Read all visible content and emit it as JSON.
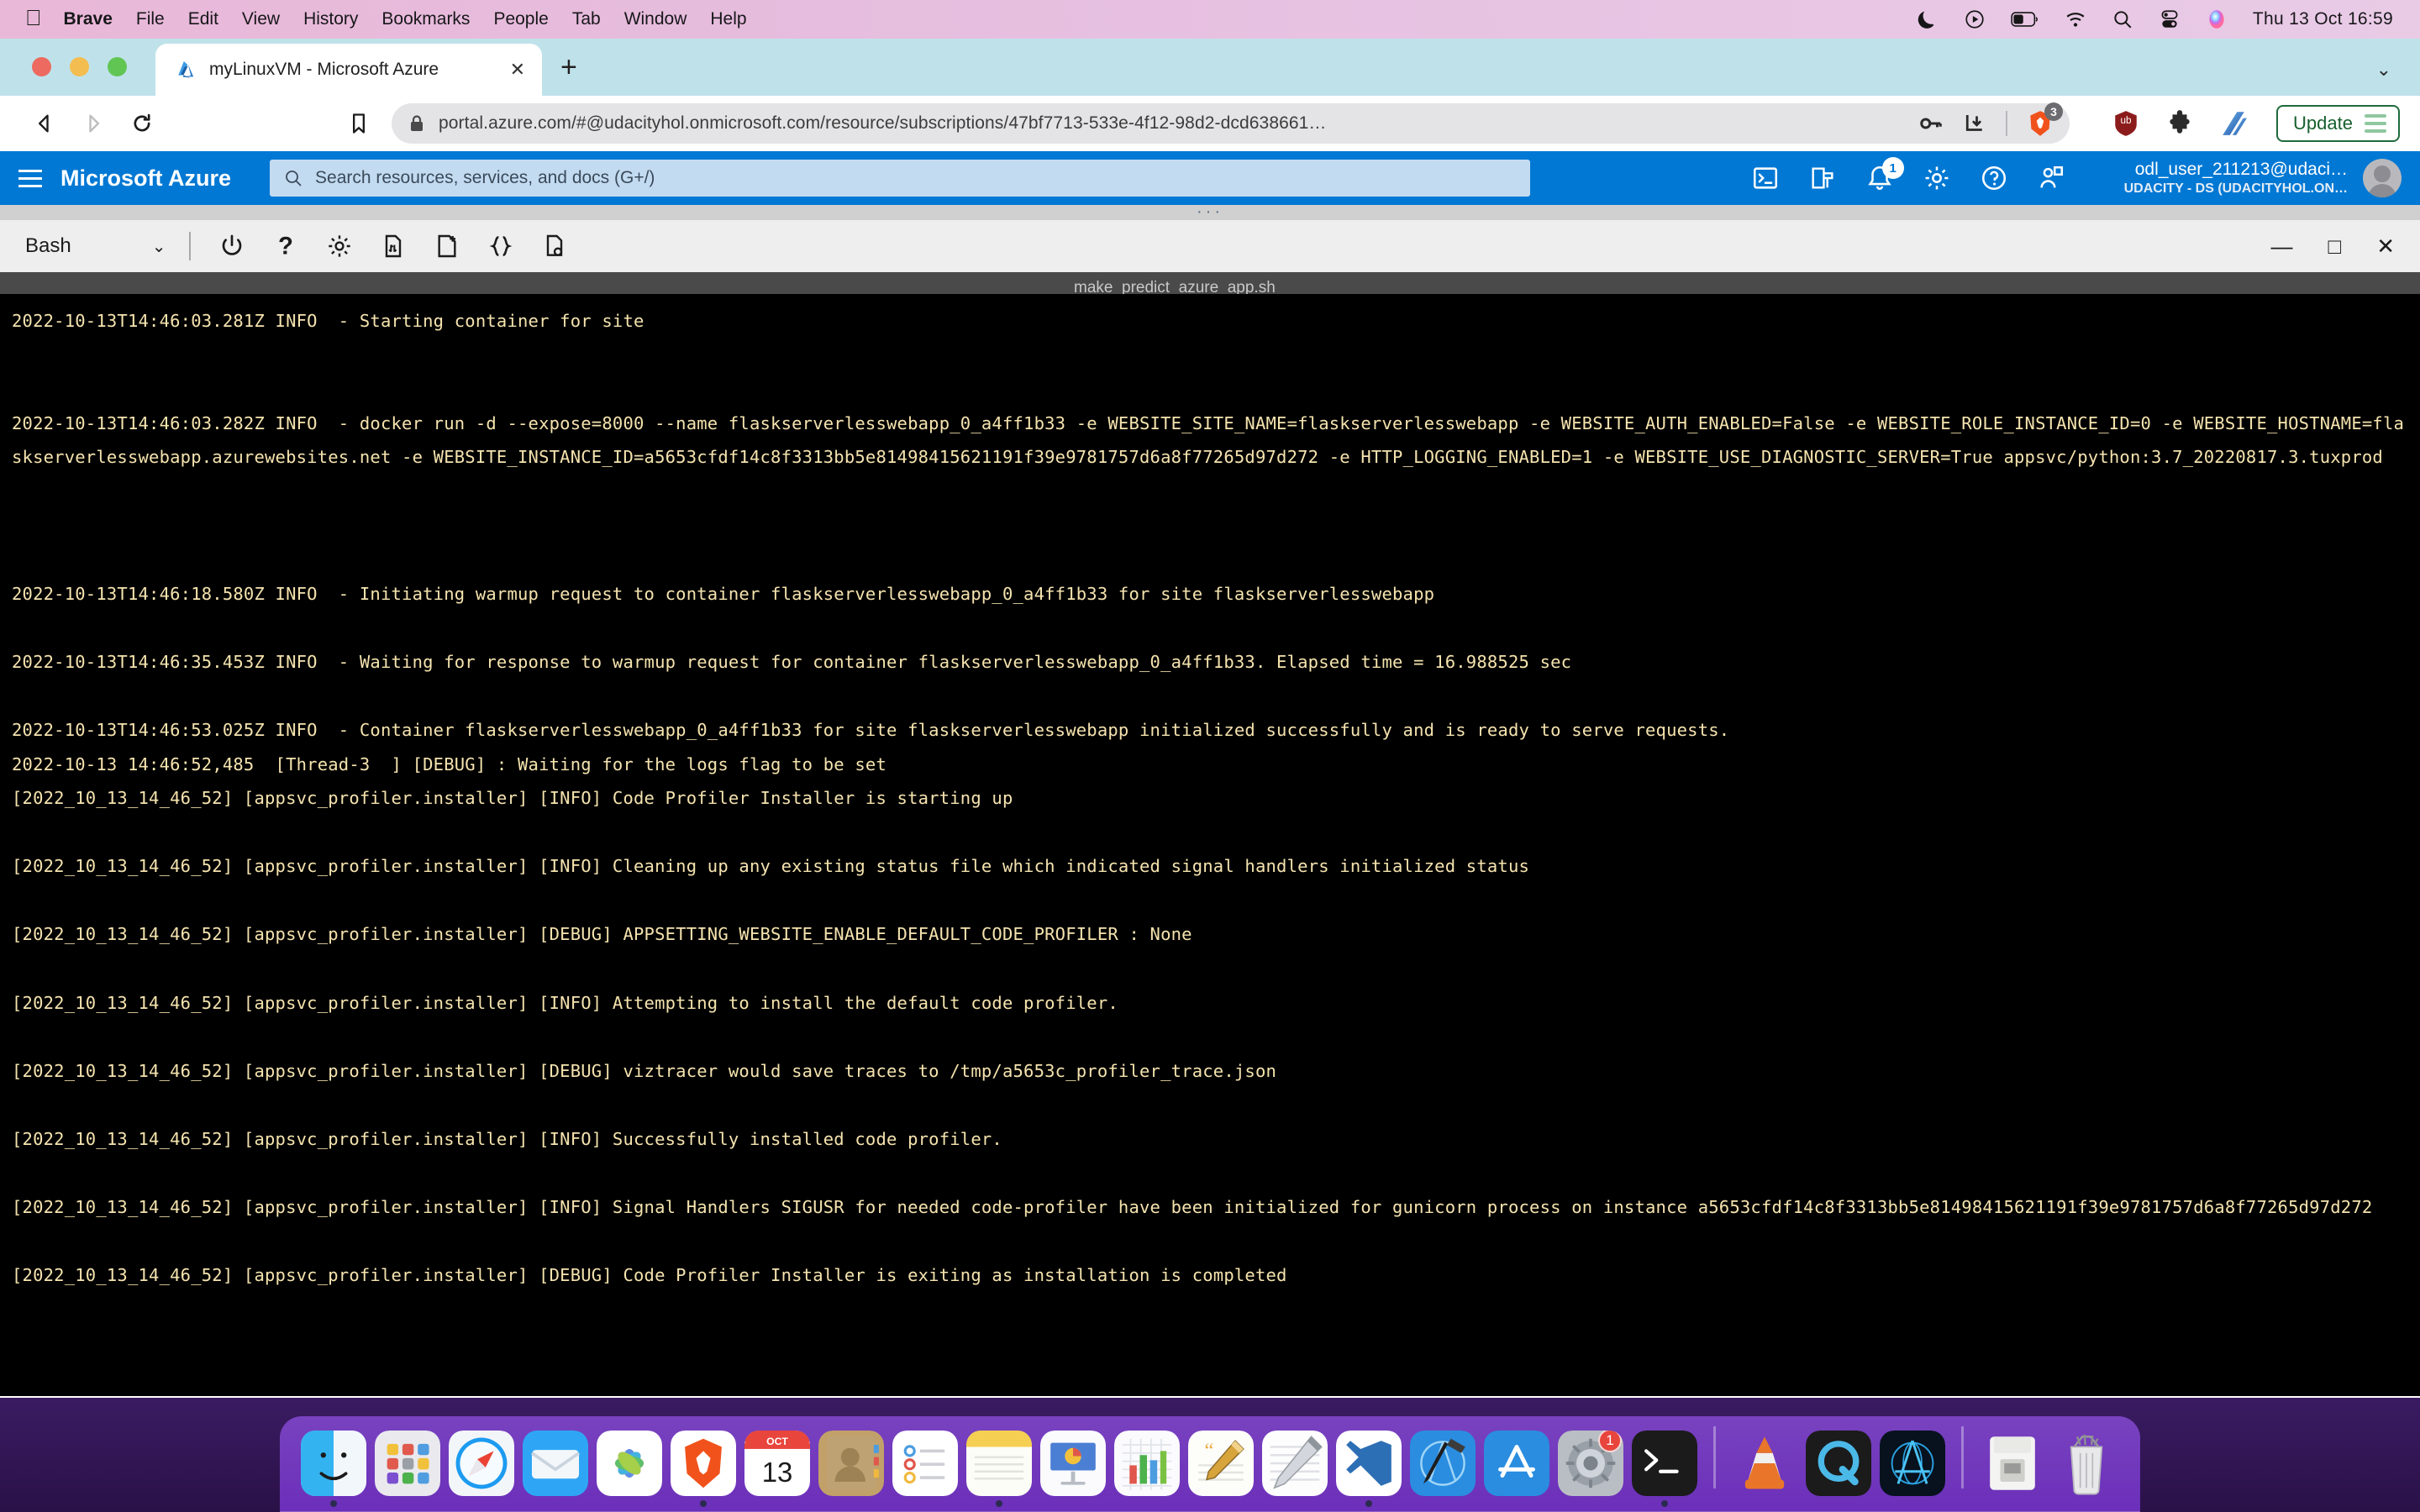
{
  "menubar": {
    "apple_icon": "apple-logo-icon",
    "items": [
      {
        "label": "Brave",
        "bold": true
      },
      {
        "label": "File",
        "bold": false
      },
      {
        "label": "Edit",
        "bold": false
      },
      {
        "label": "View",
        "bold": false
      },
      {
        "label": "History",
        "bold": false
      },
      {
        "label": "Bookmarks",
        "bold": false
      },
      {
        "label": "People",
        "bold": false
      },
      {
        "label": "Tab",
        "bold": false
      },
      {
        "label": "Window",
        "bold": false
      },
      {
        "label": "Help",
        "bold": false
      }
    ],
    "status_icons": [
      "moon-icon",
      "play-circle-icon",
      "battery-icon",
      "wifi-icon",
      "search-icon",
      "control-center-icon",
      "siri-icon"
    ],
    "clock": "Thu 13 Oct  16:59",
    "bg_color": "#e7bfdf"
  },
  "browser": {
    "tab": {
      "favicon": "azure-logo-icon",
      "title": "myLinuxVM - Microsoft Azure",
      "close_label": "✕"
    },
    "new_tab_label": "+",
    "tabstrip_chevron": "⌄",
    "nav": {
      "back_icon": "back-arrow-icon",
      "forward_icon": "forward-arrow-icon",
      "reload_icon": "reload-icon",
      "bookmark_icon": "bookmark-icon"
    },
    "omnibox": {
      "lock_icon": "lock-icon",
      "url": "portal.azure.com/#@udacityhol.onmicrosoft.com/resource/subscriptions/47bf7713-533e-4f12-98d2-dcd638661…",
      "key_icon": "password-key-icon",
      "download_icon": "download-icon",
      "brave_shield_icon": "brave-lion-icon",
      "brave_shield_count": "3"
    },
    "extensions": [
      {
        "name": "ublock-origin-icon"
      },
      {
        "name": "puzzle-extensions-icon"
      },
      {
        "name": "grammarly-icon"
      }
    ],
    "update_button": {
      "label": "Update",
      "menu_icon": "hamburger-menu-icon",
      "border_color": "#1f6b3b"
    },
    "tabstrip_bg": "#bfe2ea"
  },
  "azure": {
    "menu_icon": "hamburger-menu-icon",
    "brand": "Microsoft Azure",
    "search": {
      "icon": "search-icon",
      "placeholder": "Search resources, services, and docs (G+/)"
    },
    "header_icons": [
      {
        "name": "cloud-shell-icon"
      },
      {
        "name": "directories-subscriptions-icon"
      },
      {
        "name": "notifications-bell-icon",
        "badge": "1"
      },
      {
        "name": "settings-gear-icon"
      },
      {
        "name": "help-question-icon"
      },
      {
        "name": "feedback-icon"
      }
    ],
    "account": {
      "email": "odl_user_211213@udaci…",
      "tenant": "UDACITY - DS (UDACITYHOL.ON…",
      "avatar": "user-avatar"
    },
    "accent_color": "#0078d4"
  },
  "cloudshell": {
    "shell_select": {
      "value": "Bash",
      "chevron": "⌄"
    },
    "toolbar_icons": [
      {
        "name": "restart-power-icon"
      },
      {
        "name": "help-question-icon"
      },
      {
        "name": "settings-gear-icon"
      },
      {
        "name": "upload-download-files-icon"
      },
      {
        "name": "new-session-icon"
      },
      {
        "name": "web-preview-braces-icon"
      },
      {
        "name": "editor-open-file-icon"
      }
    ],
    "window_buttons": {
      "minimize": "—",
      "maximize": "□",
      "close": "✕"
    },
    "tab_label": "make_predict_azure_app.sh",
    "terminal_fg": "#f5e3ae",
    "terminal_bg": "#000000",
    "terminal_lines": [
      "2022-10-13T14:46:03.281Z INFO  - Starting container for site",
      "",
      "",
      "2022-10-13T14:46:03.282Z INFO  - docker run -d --expose=8000 --name flaskserverlesswebapp_0_a4ff1b33 -e WEBSITE_SITE_NAME=flaskserverlesswebapp -e WEBSITE_AUTH_ENABLED=False -e WEBSITE_ROLE_INSTANCE_ID=0 -e WEBSITE_HOSTNAME=flaskserverlesswebapp.azurewebsites.net -e WEBSITE_INSTANCE_ID=a5653cfdf14c8f3313bb5e81498415621191f39e9781757d6a8f77265d97d272 -e HTTP_LOGGING_ENABLED=1 -e WEBSITE_USE_DIAGNOSTIC_SERVER=True appsvc/python:3.7_20220817.3.tuxprod",
      "",
      "",
      "",
      "2022-10-13T14:46:18.580Z INFO  - Initiating warmup request to container flaskserverlesswebapp_0_a4ff1b33 for site flaskserverlesswebapp",
      "",
      "2022-10-13T14:46:35.453Z INFO  - Waiting for response to warmup request for container flaskserverlesswebapp_0_a4ff1b33. Elapsed time = 16.988525 sec",
      "",
      "2022-10-13T14:46:53.025Z INFO  - Container flaskserverlesswebapp_0_a4ff1b33 for site flaskserverlesswebapp initialized successfully and is ready to serve requests.",
      "2022-10-13 14:46:52,485  [Thread-3  ] [DEBUG] : Waiting for the logs flag to be set",
      "[2022_10_13_14_46_52] [appsvc_profiler.installer] [INFO] Code Profiler Installer is starting up",
      "",
      "[2022_10_13_14_46_52] [appsvc_profiler.installer] [INFO] Cleaning up any existing status file which indicated signal handlers initialized status",
      "",
      "[2022_10_13_14_46_52] [appsvc_profiler.installer] [DEBUG] APPSETTING_WEBSITE_ENABLE_DEFAULT_CODE_PROFILER : None",
      "",
      "[2022_10_13_14_46_52] [appsvc_profiler.installer] [INFO] Attempting to install the default code profiler.",
      "",
      "[2022_10_13_14_46_52] [appsvc_profiler.installer] [DEBUG] viztracer would save traces to /tmp/a5653c_profiler_trace.json",
      "",
      "[2022_10_13_14_46_52] [appsvc_profiler.installer] [INFO] Successfully installed code profiler.",
      "",
      "[2022_10_13_14_46_52] [appsvc_profiler.installer] [INFO] Signal Handlers SIGUSR for needed code-profiler have been initialized for gunicorn process on instance a5653cfdf14c8f3313bb5e81498415621191f39e9781757d6a8f77265d97d272",
      "",
      "[2022_10_13_14_46_52] [appsvc_profiler.installer] [DEBUG] Code Profiler Installer is exiting as installation is completed"
    ]
  },
  "dock": {
    "bg_color": "#7e46c8",
    "items": [
      {
        "name": "finder-icon",
        "label": "Finder",
        "running": true
      },
      {
        "name": "launchpad-icon",
        "label": "Launchpad",
        "running": false
      },
      {
        "name": "safari-icon",
        "label": "Safari",
        "running": false
      },
      {
        "name": "mail-icon",
        "label": "Mail",
        "running": false
      },
      {
        "name": "photos-icon",
        "label": "Photos",
        "running": false
      },
      {
        "name": "brave-browser-icon",
        "label": "Brave Browser",
        "running": true
      },
      {
        "name": "calendar-icon",
        "label": "Calendar",
        "running": false,
        "month": "OCT",
        "day": "13"
      },
      {
        "name": "contacts-icon",
        "label": "Contacts",
        "running": false
      },
      {
        "name": "reminders-icon",
        "label": "Reminders",
        "running": false
      },
      {
        "name": "notes-icon",
        "label": "Notes",
        "running": true
      },
      {
        "name": "keynote-icon",
        "label": "Keynote",
        "running": false
      },
      {
        "name": "numbers-icon",
        "label": "Numbers",
        "running": false
      },
      {
        "name": "pages-icon",
        "label": "Pages",
        "running": false
      },
      {
        "name": "textedit-icon",
        "label": "TextEdit",
        "running": false
      },
      {
        "name": "vscode-icon",
        "label": "Visual Studio Code",
        "running": true
      },
      {
        "name": "xcode-icon",
        "label": "Xcode",
        "running": false
      },
      {
        "name": "app-store-icon",
        "label": "App Store",
        "running": false
      },
      {
        "name": "system-preferences-icon",
        "label": "System Preferences",
        "running": false,
        "badge": "1"
      },
      {
        "name": "terminal-icon",
        "label": "Terminal",
        "running": true
      },
      {
        "separator": true
      },
      {
        "name": "vlc-icon",
        "label": "VLC",
        "running": false
      },
      {
        "name": "quicktime-icon",
        "label": "QuickTime Player",
        "running": false
      },
      {
        "name": "xquartz-icon",
        "label": "XQuartz",
        "running": false
      },
      {
        "separator": true
      },
      {
        "name": "downloads-stack-icon",
        "label": "Downloads",
        "running": false
      },
      {
        "name": "trash-icon",
        "label": "Trash",
        "running": false
      }
    ]
  }
}
